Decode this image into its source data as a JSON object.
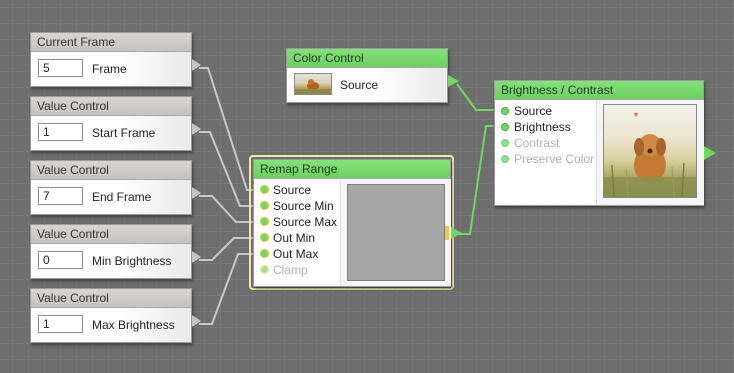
{
  "colors": {
    "canvas": "#6e6e6e",
    "wire_gray": "#c8c8c8",
    "wire_green": "#6ed862",
    "header_gray": "#cfcdc8",
    "header_green": "#78d86e",
    "selected_outline": "#f4f0b0"
  },
  "nodes": {
    "current_frame": {
      "title": "Current Frame",
      "value": "5",
      "label": "Frame"
    },
    "start_frame": {
      "title": "Value Control",
      "value": "1",
      "label": "Start Frame"
    },
    "end_frame": {
      "title": "Value Control",
      "value": "7",
      "label": "End Frame"
    },
    "min_brightness": {
      "title": "Value Control",
      "value": "0",
      "label": "Min Brightness"
    },
    "max_brightness": {
      "title": "Value Control",
      "value": "1",
      "label": "Max Brightness"
    },
    "color_control": {
      "title": "Color Control",
      "label": "Source",
      "thumbnail_icon": "dog-photo-thumbnail"
    },
    "remap_range": {
      "title": "Remap Range",
      "inputs": [
        "Source",
        "Source Min",
        "Source Max",
        "Out Min",
        "Out Max",
        "Clamp"
      ],
      "preview_color": "#a7a7a7"
    },
    "brightness_contrast": {
      "title": "Brightness / Contrast",
      "inputs": [
        "Source",
        "Brightness",
        "Contrast",
        "Preserve Color"
      ],
      "preview_icon": "dog-in-field-photo"
    }
  }
}
